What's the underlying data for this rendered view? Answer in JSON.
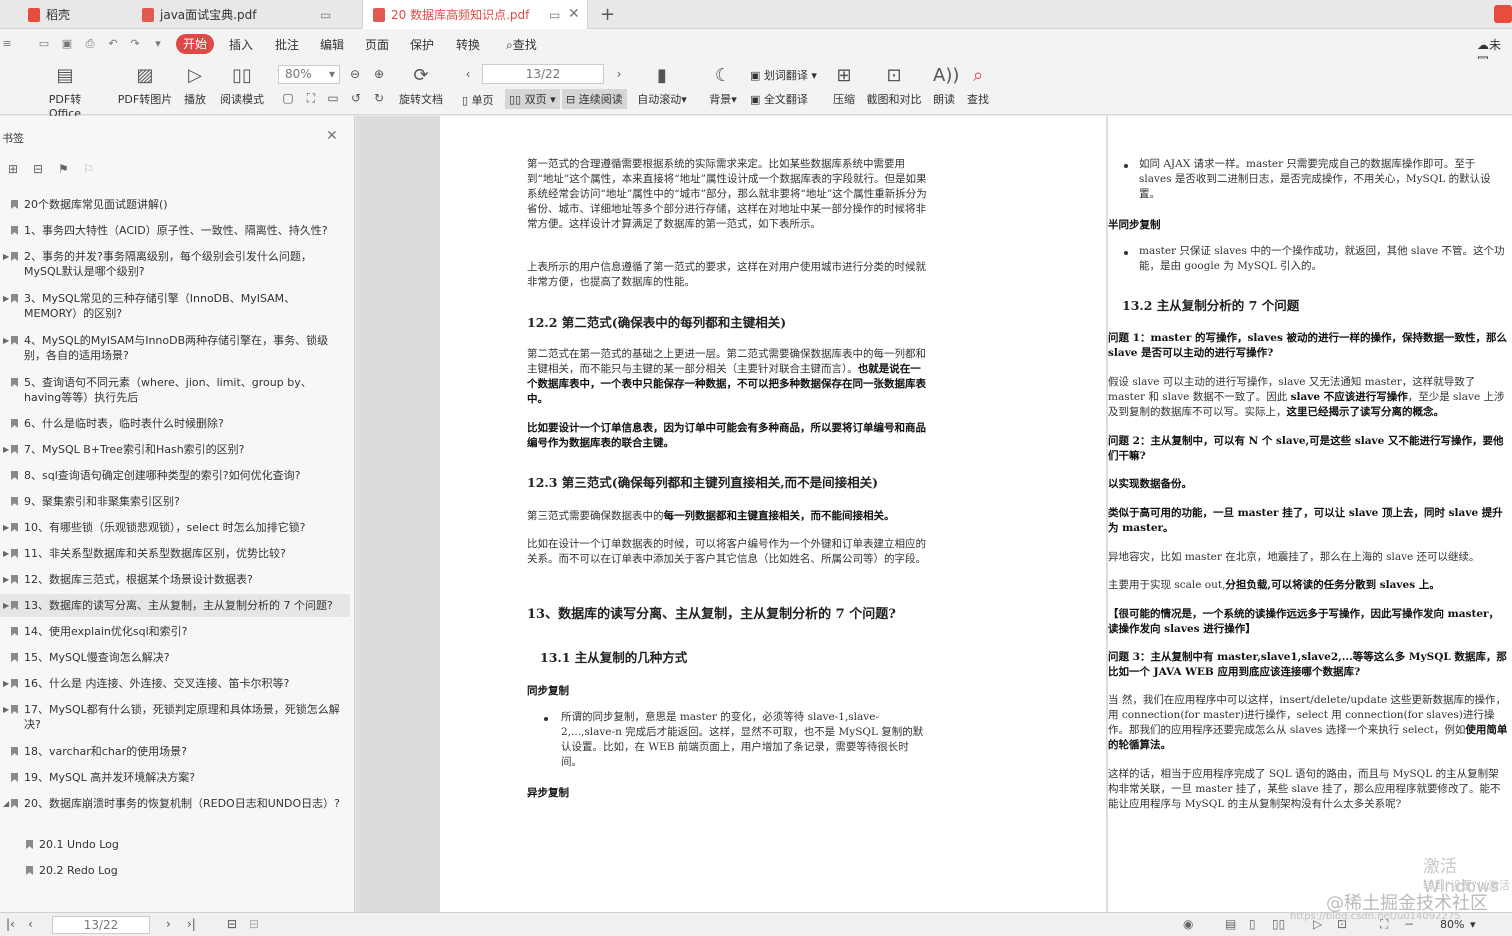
{
  "tabs": [
    {
      "label": "稻壳",
      "color": "#e74c3c"
    },
    {
      "label": "java面试宝典.pdf",
      "color": "#e05a4f"
    },
    {
      "label": "20 数据库高频知识点.pdf",
      "color": "#e05a4f"
    }
  ],
  "menu": {
    "start": "开始",
    "insert": "插入",
    "annotate": "批注",
    "edit": "编辑",
    "page": "页面",
    "protect": "保护",
    "convert": "转换",
    "search": "查找",
    "cloud": "未同"
  },
  "ribbon": {
    "pdf_to_office": "PDF转Office",
    "pdf_to_image": "PDF转图片",
    "play": "播放",
    "read_mode": "阅读模式",
    "zoom": "80%",
    "rotate": "旋转文档",
    "page_input": "13/22",
    "single": "单页",
    "double": "双页",
    "continuous": "连续阅读",
    "auto_scroll": "自动滚动",
    "background": "背景",
    "word_translate": "划词翻译",
    "full_translate": "全文翻译",
    "compress": "压缩",
    "screenshot_compare": "截图和对比",
    "read_aloud": "朗读",
    "find": "查找"
  },
  "sidebar": {
    "title": "书签",
    "items": [
      {
        "text": "20个数据库常见面试题讲解()",
        "tri": ""
      },
      {
        "text": "1、事务四大特性（ACID）原子性、一致性、隔离性、持久性?",
        "tri": ""
      },
      {
        "text": "2、事务的并发?事务隔离级别，每个级别会引发什么问题，MySQL默认是哪个级别?",
        "tri": "▶"
      },
      {
        "text": "3、MySQL常见的三种存储引擎（InnoDB、MyISAM、MEMORY）的区别?",
        "tri": "▶"
      },
      {
        "text": "4、MySQL的MyISAM与InnoDB两种存储引擎在，事务、锁级别，各自的适用场景?",
        "tri": "▶"
      },
      {
        "text": "5、查询语句不同元素（where、jion、limit、group by、having等等）执行先后",
        "tri": ""
      },
      {
        "text": "6、什么是临时表，临时表什么时候删除?",
        "tri": ""
      },
      {
        "text": "7、MySQL B+Tree索引和Hash索引的区别?",
        "tri": "▶"
      },
      {
        "text": "8、sql查询语句确定创建哪种类型的索引?如何优化查询?",
        "tri": ""
      },
      {
        "text": "9、聚集索引和非聚集索引区别?",
        "tri": ""
      },
      {
        "text": "10、有哪些锁（乐观锁悲观锁），select 时怎么加排它锁?",
        "tri": "▶"
      },
      {
        "text": "11、非关系型数据库和关系型数据库区别，优势比较?",
        "tri": "▶"
      },
      {
        "text": "12、数据库三范式，根据某个场景设计数据表?",
        "tri": "▶"
      },
      {
        "text": "13、数据库的读写分离、主从复制，主从复制分析的 7 个问题?",
        "tri": "▶"
      },
      {
        "text": "14、使用explain优化sql和索引?",
        "tri": ""
      },
      {
        "text": "15、MySQL慢查询怎么解决?",
        "tri": ""
      },
      {
        "text": "16、什么是 内连接、外连接、交叉连接、笛卡尔积等?",
        "tri": "▶"
      },
      {
        "text": "17、MySQL都有什么锁，死锁判定原理和具体场景，死锁怎么解决?",
        "tri": "▶"
      },
      {
        "text": "18、varchar和char的使用场景?",
        "tri": ""
      },
      {
        "text": "19、MySQL 高并发环境解决方案?",
        "tri": ""
      },
      {
        "text": "20、数据库崩溃时事务的恢复机制（REDO日志和UNDO日志）?",
        "tri": "◢"
      },
      {
        "text": "20.1 Undo Log",
        "tri": ""
      },
      {
        "text": "20.2 Redo Log",
        "tri": ""
      }
    ]
  },
  "left_page": {
    "p1": "第一范式的合理遵循需要根据系统的实际需求来定。比如某些数据库系统中需要用到“地址”这个属性，本来直接将“地址”属性设计成一个数据库表的字段就行。但是如果系统经常会访问“地址”属性中的“城市”部分，那么就非要将“地址”这个属性重新拆分为省份、城市、详细地址等多个部分进行存储，这样在对地址中某一部分操作的时候将非常方便。这样设计才算满足了数据库的第一范式，如下表所示。",
    "p2": "上表所示的用户信息遵循了第一范式的要求，这样在对用户使用城市进行分类的时候就非常方便，也提高了数据库的性能。",
    "h122": "12.2 第二范式(确保表中的每列都和主键相关)",
    "p3a": "第二范式在第一范式的基础之上更进一层。第二范式需要确保数据库表中的每一列都和主键相关，而不能只与主键的某一部分相关（主要针对联合主键而言）。",
    "p3b": "也就是说在一个数据库表中，一个表中只能保存一种数据，不可以把多种数据保存在同一张数据库表中。",
    "p4": "比如要设计一个订单信息表，因为订单中可能会有多种商品，所以要将订单编号和商品编号作为数据库表的联合主键。",
    "h123": "12.3 第三范式(确保每列都和主键列直接相关,而不是间接相关)",
    "p5a": "第三范式需要确保数据表中的",
    "p5b": "每一列数据都和主键直接相关，而不能间接相关。",
    "p6": "比如在设计一个订单数据表的时候，可以将客户编号作为一个外键和订单表建立相应的关系。而不可以在订单表中添加关于客户其它信息（比如姓名、所属公司等）的字段。",
    "h13": "13、数据库的读写分离、主从复制，主从复制分析的 7 个问题?",
    "h131": "13.1 主从复制的几种方式",
    "sync": "同步复制",
    "sync_li": "所谓的同步复制，意思是 master 的变化，必须等待 slave-1,slave-2,...,slave-n 完成后才能返回。这样，显然不可取，也不是 MySQL 复制的默认设置。比如，在 WEB 前端页面上，用户增加了条记录，需要等待很长时间。",
    "async": "异步复制"
  },
  "right_page": {
    "li1": "如同 AJAX 请求一样。master 只需要完成自己的数据库操作即可。至于 slaves 是否收到二进制日志，是否完成操作，不用关心，MySQL 的默认设置。",
    "semi": "半同步复制",
    "li2": "master 只保证 slaves 中的一个操作成功，就返回，其他 slave 不管。这个功能，是由 google 为 MySQL 引入的。",
    "h132": "13.2 主从复制分析的 7 个问题",
    "q1": "问题 1：master 的写操作，slaves 被动的进行一样的操作，保持数据一致性，那么 slave 是否可以主动的进行写操作?",
    "a1a": "假设 slave 可以主动的进行写操作，slave 又无法通知 master，这样就导致了 master 和 slave 数据不一致了。因此 ",
    "a1b": "slave 不应该进行写操作",
    "a1c": "，至少是 slave 上涉及到复制的数据库不可以写。实际上，",
    "a1d": "这里已经揭示了读写分离的概念。",
    "q2": "问题 2：主从复制中，可以有 N 个 slave,可是这些 slave 又不能进行写操作，要他们干嘛?",
    "a2": "以实现数据备份。",
    "a3": "类似于高可用的功能，一旦 master 挂了，可以让 slave 顶上去，同时 slave 提升为 master。",
    "a4": "异地容灾，比如 master 在北京，地震挂了，那么在上海的 slave 还可以继续。",
    "a5a": "主要用于实现 scale out,",
    "a5b": "分担负载,可以将读的任务分散到 slaves 上。",
    "a6": "【很可能的情况是，一个系统的读操作远远多于写操作，因此写操作发向 master，读操作发向 slaves 进行操作】",
    "q3": "问题 3：主从复制中有 master,slave1,slave2,...等等这么多 MySQL 数据库，那比如一个 JAVA WEB 应用到底应该连接哪个数据库?",
    "a7a": "当 然，我们在应用程序中可以这样，insert/delete/update 这些更新数据库的操作，用 connection(for master)进行操作，select 用 connection(for slaves)进行操作。那我们的应用程序还要完成怎么从 slaves 选择一个来执行 select，例如",
    "a7b": "使用简单的轮循算法。",
    "a8": "这样的话，相当于应用程序完成了 SQL 语句的路由，而且与 MySQL 的主从复制架构非常关联，一旦 master 挂了，某些 slave 挂了，那么应用程序就要修改了。能不能让应用程序与 MySQL 的主从复制架构没有什么太多关系呢?"
  },
  "status": {
    "page_input": "13/22",
    "zoom": "80%"
  },
  "watermark": {
    "activate": "激活 Windows",
    "activate_sub": "转到\"设置\"以激活",
    "juejin": "@稀土掘金技术社区",
    "url": "https://blog.csdn.net/u014092275"
  }
}
